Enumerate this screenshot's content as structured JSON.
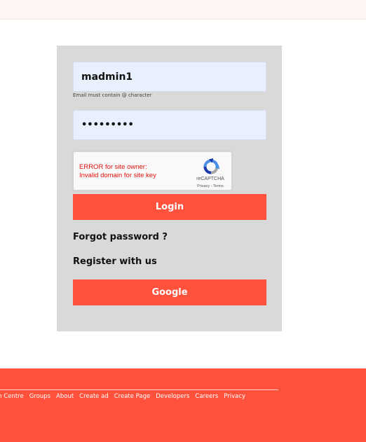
{
  "login": {
    "username_value": "madmin1",
    "email_hint": "Email must contain @ character",
    "password_value": "•••••••••",
    "captcha": {
      "error_line1": "ERROR for site owner:",
      "error_line2": "Invalid domain for site key",
      "brand": "reCAPTCHA",
      "terms": "Privacy - Terms"
    },
    "login_button": "Login",
    "forgot_link": "Forgot password ?",
    "register_link": "Register with us",
    "google_button": "Google"
  },
  "footer": {
    "links": [
      "on Centre",
      "Groups",
      "About",
      "Create ad",
      "Create Page",
      "Developers",
      "Careers",
      "Privacy"
    ]
  },
  "colors": {
    "accent": "#ff513b",
    "card_bg": "#d9d9d9",
    "input_bg": "#e8f0fe"
  }
}
